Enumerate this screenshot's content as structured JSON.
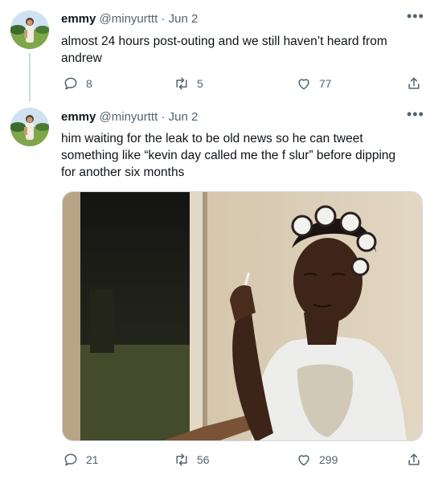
{
  "tweets": [
    {
      "author_name": "emmy",
      "handle": "@minyurttt",
      "dot": "·",
      "date": "Jun 2",
      "text": "almost 24 hours post-outing and we still haven’t heard from\nandrew",
      "reply_count": "8",
      "retweet_count": "5",
      "like_count": "77",
      "more_icon": "more-icon"
    },
    {
      "author_name": "emmy",
      "handle": "@minyurttt",
      "dot": "·",
      "date": "Jun 2",
      "text": "him waiting for the leak to be old news so he can tweet\nsomething like “kevin day called me the f slur” before dipping\nfor another six months",
      "reply_count": "21",
      "retweet_count": "56",
      "like_count": "299",
      "more_icon": "more-icon"
    }
  ],
  "icons": [
    "reply-icon",
    "retweet-icon",
    "like-icon",
    "share-icon"
  ]
}
